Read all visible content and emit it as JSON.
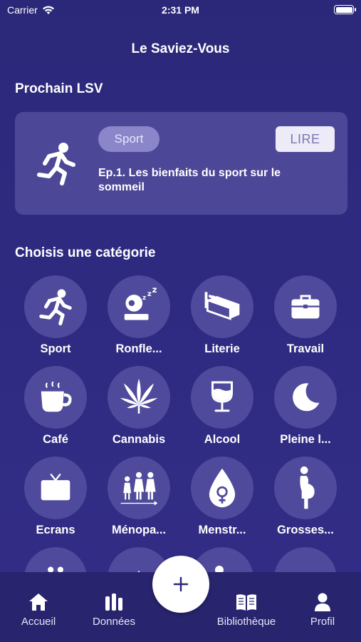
{
  "status_bar": {
    "carrier": "Carrier",
    "time": "2:31 PM"
  },
  "header": {
    "title": "Le Saviez-Vous"
  },
  "next_section": {
    "title": "Prochain LSV",
    "card": {
      "icon": "runner-icon",
      "category_chip": "Sport",
      "read_button": "LIRE",
      "episode_title": "Ep.1. Les bienfaits du sport sur le sommeil"
    }
  },
  "categories_section": {
    "title": "Choisis une catégorie",
    "items": [
      {
        "label": "Sport",
        "icon": "runner-icon"
      },
      {
        "label": "Ronfle...",
        "icon": "snoring-icon"
      },
      {
        "label": "Literie",
        "icon": "bed-icon"
      },
      {
        "label": "Travail",
        "icon": "briefcase-icon"
      },
      {
        "label": "Café",
        "icon": "coffee-cup-icon"
      },
      {
        "label": "Cannabis",
        "icon": "cannabis-leaf-icon"
      },
      {
        "label": "Alcool",
        "icon": "wine-glass-icon"
      },
      {
        "label": "Pleine l...",
        "icon": "crescent-moon-icon"
      },
      {
        "label": "Ecrans",
        "icon": "tv-icon"
      },
      {
        "label": "Ménopa...",
        "icon": "women-ages-icon"
      },
      {
        "label": "Menstr...",
        "icon": "drop-female-icon"
      },
      {
        "label": "Grosses...",
        "icon": "pregnant-woman-icon"
      }
    ]
  },
  "tab_bar": {
    "items": [
      {
        "label": "Accueil",
        "icon": "home-icon"
      },
      {
        "label": "Données",
        "icon": "bar-chart-icon"
      },
      {
        "label": "Bibliothèque",
        "icon": "book-icon"
      },
      {
        "label": "Profil",
        "icon": "person-icon"
      }
    ],
    "fab_icon": "plus-icon"
  },
  "colors": {
    "background": "#2e2a80",
    "card": "#4d4797",
    "circle": "#4f4a9b",
    "chip": "#8b86c9",
    "tab_bar": "#28246e"
  }
}
